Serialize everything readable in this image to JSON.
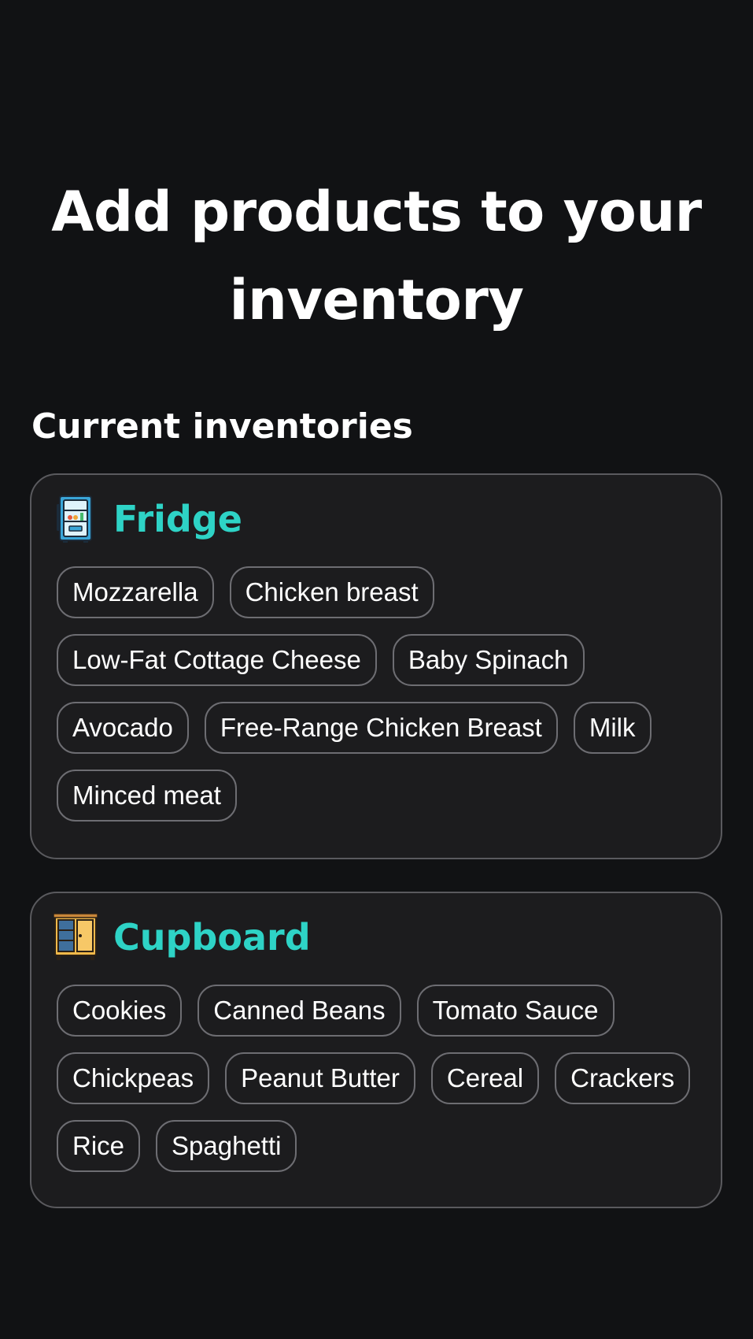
{
  "header": {
    "title_line1": "Add products to your",
    "title_line2": "inventory"
  },
  "section": {
    "title": "Current inventories"
  },
  "inventories": [
    {
      "name": "Fridge",
      "icon": "fridge-icon",
      "items": [
        "Mozzarella",
        "Chicken breast",
        "Low-Fat Cottage Cheese",
        "Baby Spinach",
        "Avocado",
        "Free-Range Chicken Breast",
        "Milk",
        "Minced meat"
      ]
    },
    {
      "name": "Cupboard",
      "icon": "cupboard-icon",
      "items": [
        "Cookies",
        "Canned Beans",
        "Tomato Sauce",
        "Chickpeas",
        "Peanut Butter",
        "Cereal",
        "Crackers",
        "Rice",
        "Spaghetti"
      ]
    }
  ],
  "colors": {
    "background": "#111214",
    "card": "#1c1c1e",
    "card_border": "#5a5a5e",
    "accent": "#2ed3c6",
    "text": "#ffffff"
  }
}
